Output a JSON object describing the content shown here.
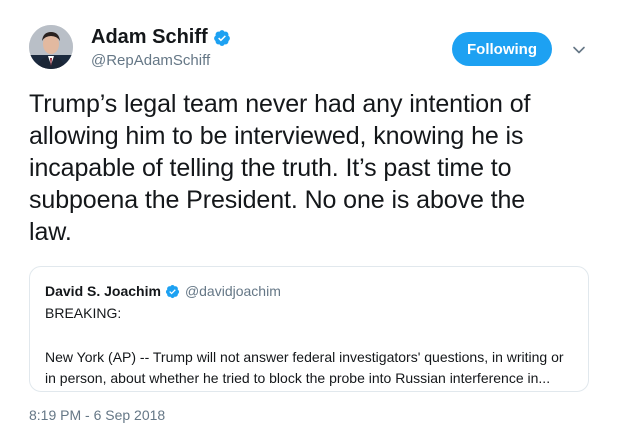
{
  "author": {
    "name": "Adam Schiff",
    "handle": "@RepAdamSchiff",
    "avatar_icon": "profile-photo",
    "verified_icon": "verified-badge-icon"
  },
  "actions": {
    "follow_label": "Following",
    "more_icon": "chevron-down-icon"
  },
  "tweet": {
    "lines": [
      "Trump’s legal team never had any intention of",
      "allowing him to be interviewed, knowing he is",
      "incapable of telling the truth. It’s past time to",
      "subpoena the President. No one is above the",
      "law."
    ]
  },
  "quoted_tweet": {
    "name": "David S. Joachim",
    "handle": "@davidjoachim",
    "breaking": "BREAKING:",
    "body_lines": [
      "New York (AP) -- Trump will not answer federal investigators' questions, in writing or",
      "in person, about whether he tried to block the probe into Russian interference in..."
    ]
  },
  "timestamp": "8:19 PM - 6 Sep 2018",
  "colors": {
    "accent": "#1da1f2",
    "text": "#14171a",
    "muted": "#657786",
    "border": "#e1e8ed"
  }
}
